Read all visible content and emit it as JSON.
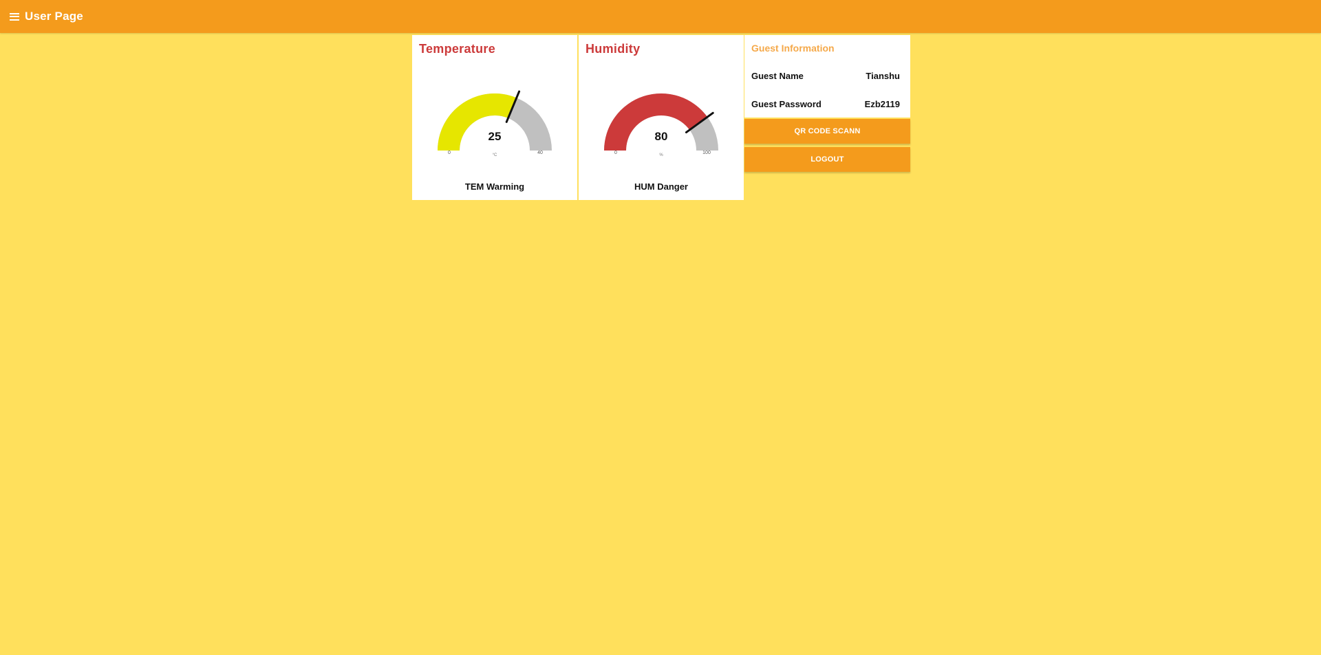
{
  "header": {
    "title": "User Page",
    "menu_icon": "hamburger-menu-icon",
    "background": "#f49b1c"
  },
  "colors": {
    "page_background": "#ffe05c",
    "card_title": "#cc3a3a",
    "guest_title": "#f5a94a",
    "button": "#f49b1c",
    "gauge_track": "#c0c0c0",
    "needle": "#111111"
  },
  "temperature": {
    "title": "Temperature",
    "value": "25",
    "min": "0",
    "max": "40",
    "unit": "°C",
    "status": "TEM Warming",
    "fill_color": "#e6e600"
  },
  "humidity": {
    "title": "Humidity",
    "value": "80",
    "min": "0",
    "max": "100",
    "unit": "%",
    "status": "HUM Danger",
    "fill_color": "#cc3a3a"
  },
  "guest": {
    "title": "Guest Information",
    "name_label": "Guest Name",
    "name_value": "Tianshu",
    "password_label": "Guest Password",
    "password_value": "Ezb2119"
  },
  "buttons": {
    "qr": "QR CODE SCANN",
    "logout": "LOGOUT"
  }
}
